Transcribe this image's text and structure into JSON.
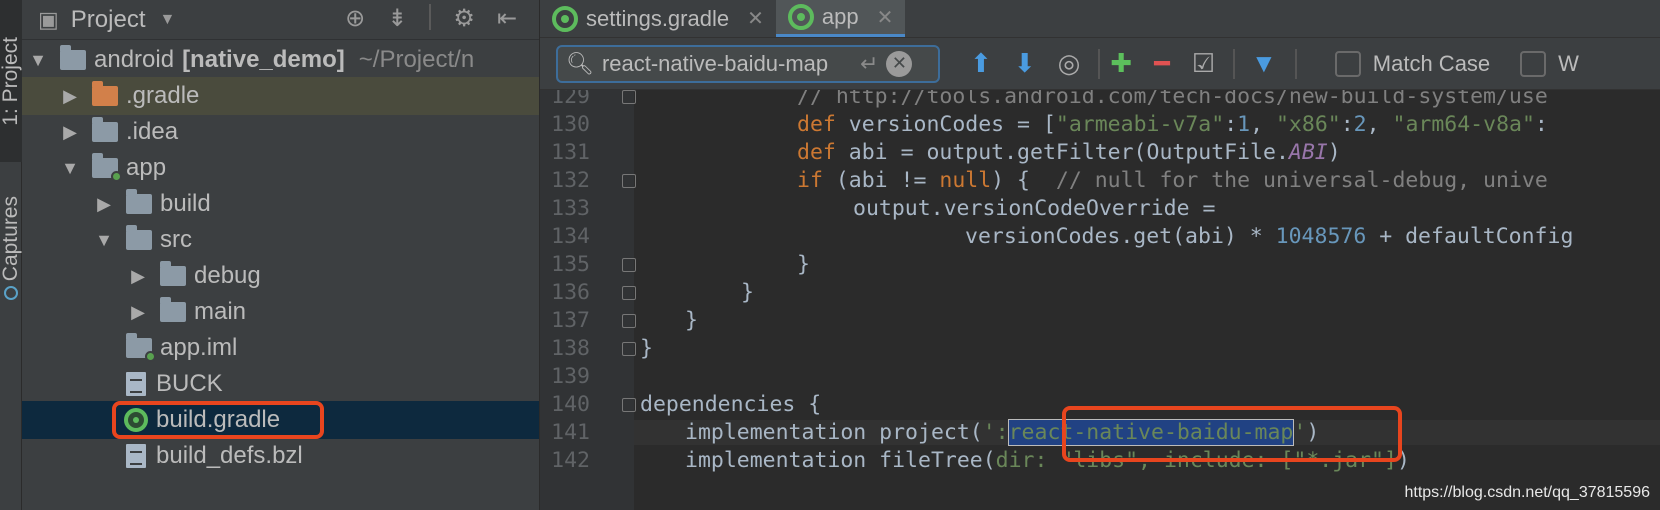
{
  "stripe": {
    "project_label": "1: Project",
    "captures_label": "Captures"
  },
  "project_panel": {
    "title": "Project",
    "tree": [
      {
        "label": "android",
        "suffix": "[native_demo]",
        "path": "~/Project/n"
      },
      {
        "label": ".gradle"
      },
      {
        "label": ".idea"
      },
      {
        "label": "app"
      },
      {
        "label": "build"
      },
      {
        "label": "src"
      },
      {
        "label": "debug"
      },
      {
        "label": "main"
      },
      {
        "label": "app.iml"
      },
      {
        "label": "BUCK"
      },
      {
        "label": "build.gradle"
      },
      {
        "label": "build_defs.bzl"
      }
    ]
  },
  "tabs": [
    {
      "label": "settings.gradle",
      "active": false
    },
    {
      "label": "app",
      "active": true
    }
  ],
  "search": {
    "value": "react-native-baidu-map",
    "match_case_label": "Match Case",
    "words_label": "W"
  },
  "code": {
    "lines": [
      {
        "n": "129",
        "t": "// http://tools.android.com/tech-docs/new-build-system/use"
      },
      {
        "n": "130"
      },
      {
        "n": "131"
      },
      {
        "n": "132"
      },
      {
        "n": "133"
      },
      {
        "n": "134"
      },
      {
        "n": "135"
      },
      {
        "n": "136"
      },
      {
        "n": "137"
      },
      {
        "n": "138"
      },
      {
        "n": "139"
      },
      {
        "n": "140"
      },
      {
        "n": "141"
      },
      {
        "n": "142"
      }
    ]
  },
  "watermark": "https://blog.csdn.net/qq_37815596",
  "colors": {
    "highlight_box": "#e8451e",
    "selection_row": "#0d293e",
    "accent_blue": "#4a88c7"
  }
}
